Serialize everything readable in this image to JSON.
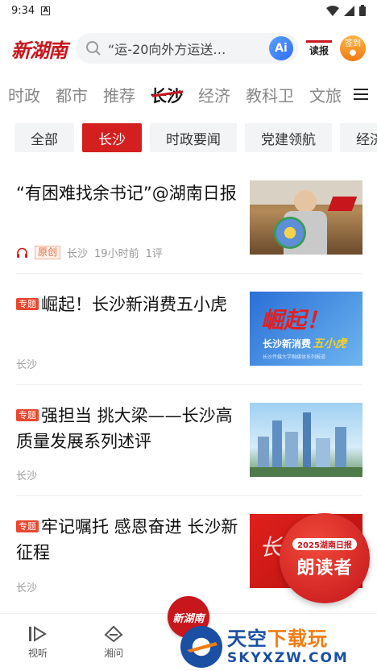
{
  "status": {
    "time": "9:34",
    "notice_glyph": "A"
  },
  "header": {
    "logo_text": "新湖南",
    "search_placeholder": "“运-20向外方运送…",
    "ai_label": "Ai",
    "read_paper_label": "读报",
    "signin_label": "签到"
  },
  "channels": [
    "时政",
    "都市",
    "推荐",
    "长沙",
    "经济",
    "教科卫",
    "文旅"
  ],
  "active_channel": "长沙",
  "subtabs": [
    "全部",
    "长沙",
    "时政要闻",
    "党建领航",
    "经济"
  ],
  "articles": [
    {
      "title": "“有困难找余书记”@湖南日报",
      "has_audio": true,
      "orig_label": "原创",
      "tag": "",
      "source": "长沙",
      "time": "19小时前",
      "comments": "1评"
    },
    {
      "tag": "专题",
      "title": "崛起！长沙新消费五小虎",
      "source": "长沙",
      "thumb_line1": "崛起！",
      "thumb_line2": "长沙新消费",
      "thumb_line3": "五小虎",
      "thumb_line4": "长沙传媒大学融媒体系列报道"
    },
    {
      "tag": "专题",
      "title": "强担当 挑大梁——长沙高质量发展系列述评",
      "source": "长沙"
    },
    {
      "tag": "专题",
      "title": "牢记嘱托 感恩奋进 长沙新征程",
      "source": "长沙",
      "thumb_text": "长沙"
    }
  ],
  "reader_float": {
    "sub": "2025湖南日报",
    "main": "朗读者"
  },
  "bottom_nav": {
    "item1": "视听",
    "item2": "湘问",
    "center": "新湖南"
  },
  "watermark": {
    "cn_main": "天空",
    "cn_accent": "下载玩",
    "en": "SKYXZW.COM"
  },
  "colors": {
    "brand_red": "#c8161d",
    "active_tab_bg": "#d3201f",
    "tag_red": "#e8472f",
    "watermark_blue": "#1a4fa3"
  }
}
